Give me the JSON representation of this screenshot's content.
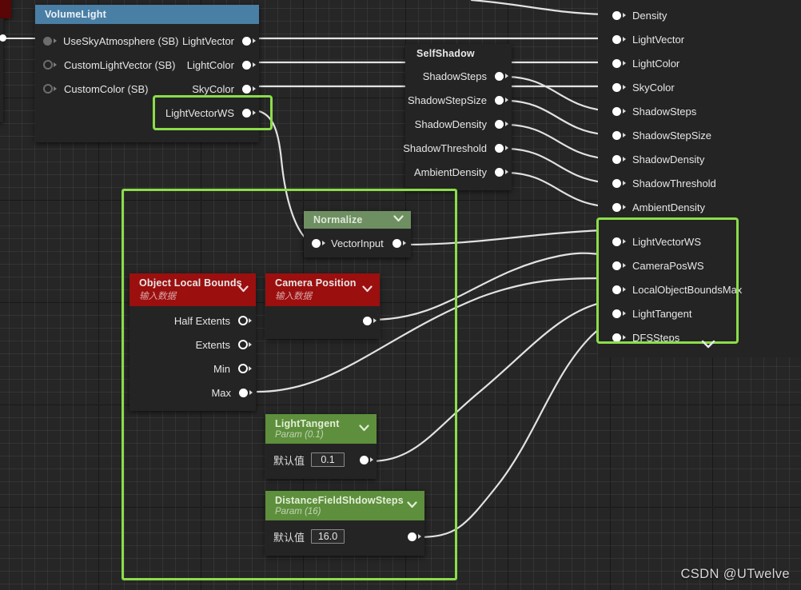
{
  "watermark": "CSDN @UTwelve",
  "colors": {
    "selection_green": "#8bdd4a",
    "header_blue": "#4a7fa5",
    "header_red": "#9b0f0f",
    "header_green": "#5d8f3c",
    "normalize_green": "#6e8f62",
    "canvas_bg": "#262626",
    "node_bg": "#242424",
    "wire": "#e0e0e0"
  },
  "nodes": {
    "volume_light": {
      "title": "VolumeLight",
      "inputs": [
        {
          "label": "UseSkyAtmosphere (SB)",
          "style": "dim"
        },
        {
          "label": "CustomLightVector (SB)",
          "style": "dimhollow"
        },
        {
          "label": "CustomColor (SB)",
          "style": "dimhollow"
        }
      ],
      "outputs": [
        {
          "label": "LightVector"
        },
        {
          "label": "LightColor"
        },
        {
          "label": "SkyColor"
        },
        {
          "label": "LightVectorWS",
          "selected": true
        }
      ]
    },
    "self_shadow": {
      "title": "SelfShadow",
      "outputs": [
        {
          "label": "ShadowSteps"
        },
        {
          "label": "ShadowStepSize"
        },
        {
          "label": "ShadowDensity"
        },
        {
          "label": "ShadowThreshold"
        },
        {
          "label": "AmbientDensity"
        }
      ]
    },
    "target_inputs": {
      "inputs_top": [
        {
          "label": "Density"
        },
        {
          "label": "LightVector"
        },
        {
          "label": "LightColor"
        },
        {
          "label": "SkyColor"
        },
        {
          "label": "ShadowSteps"
        },
        {
          "label": "ShadowStepSize"
        },
        {
          "label": "ShadowDensity"
        },
        {
          "label": "ShadowThreshold"
        },
        {
          "label": "AmbientDensity"
        }
      ],
      "inputs_selected": [
        {
          "label": "LightVectorWS"
        },
        {
          "label": "CameraPosWS"
        },
        {
          "label": "LocalObjectBoundsMax"
        },
        {
          "label": "LightTangent"
        },
        {
          "label": "DFSSteps"
        }
      ]
    },
    "normalize": {
      "title": "Normalize",
      "input": "VectorInput"
    },
    "object_local_bounds": {
      "title": "Object Local Bounds",
      "subtitle": "输入数据",
      "outputs": [
        {
          "label": "Half Extents",
          "filled": false
        },
        {
          "label": "Extents",
          "filled": false
        },
        {
          "label": "Min",
          "filled": false
        },
        {
          "label": "Max",
          "filled": true
        }
      ]
    },
    "camera_position": {
      "title": "Camera Position",
      "subtitle": "输入数据"
    },
    "light_tangent": {
      "title": "LightTangent",
      "subtitle": "Param (0.1)",
      "default_label": "默认值",
      "default_value": "0.1"
    },
    "dfss": {
      "title": "DistanceFieldShdowSteps",
      "subtitle": "Param (16)",
      "default_label": "默认值",
      "default_value": "16.0"
    }
  }
}
